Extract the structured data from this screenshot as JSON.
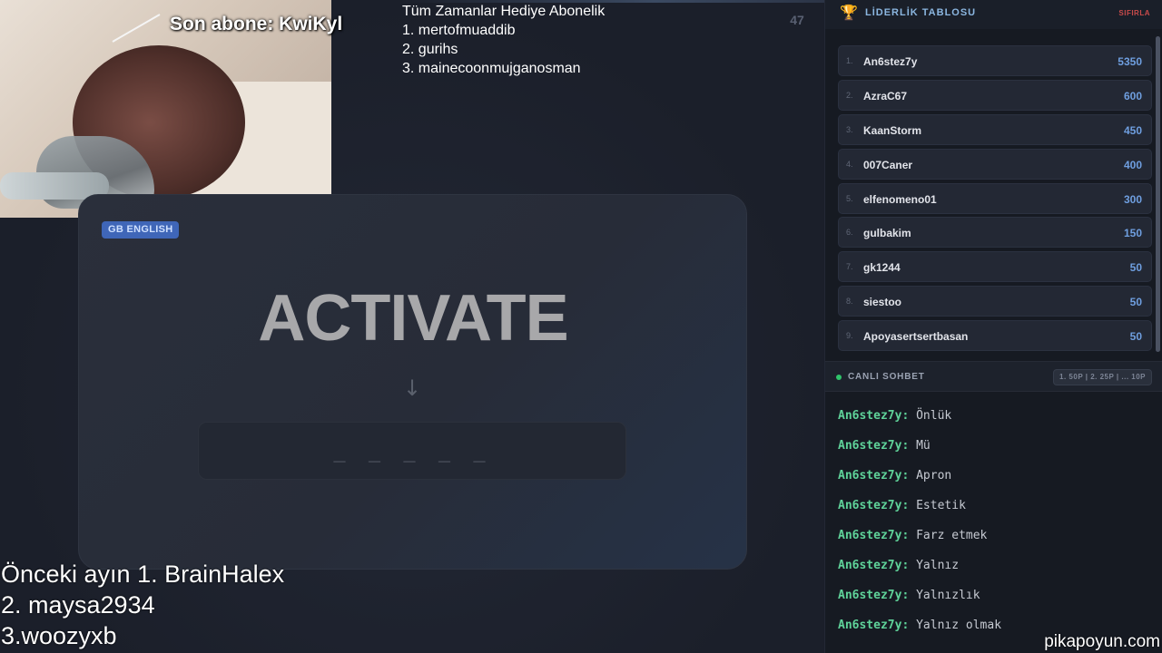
{
  "overlay": {
    "son_abone": "Son abone: KwiKyl",
    "round_counter": "47",
    "gift_list": {
      "title": "Tüm Zamanlar Hediye  Abonelik",
      "items": [
        "1. mertofmuaddib",
        "2. gurihs",
        "3. mainecoonmujganosman"
      ]
    },
    "previous_month": {
      "lines": [
        "Önceki ayın 1. BrainHalex",
        "2. maysa2934",
        "3.woozyxb"
      ]
    },
    "watermark": "pikapoyun.com"
  },
  "game": {
    "language_badge": "GB ENGLISH",
    "word": "ACTIVATE",
    "arrow": "↓",
    "input_placeholder": "_ _ _ _ _"
  },
  "leaderboard": {
    "icon": "trophy-icon",
    "title": "LİDERLİK TABLOSU",
    "reset_label": "SIFIRLA",
    "entries": [
      {
        "rank": "1.",
        "name": "An6stez7y",
        "score": "5350"
      },
      {
        "rank": "2.",
        "name": "AzraC67",
        "score": "600"
      },
      {
        "rank": "3.",
        "name": "KaanStorm",
        "score": "450"
      },
      {
        "rank": "4.",
        "name": "007Caner",
        "score": "400"
      },
      {
        "rank": "5.",
        "name": "elfenomeno01",
        "score": "300"
      },
      {
        "rank": "6.",
        "name": "gulbakim",
        "score": "150"
      },
      {
        "rank": "7.",
        "name": "gk1244",
        "score": "50"
      },
      {
        "rank": "8.",
        "name": "siestoo",
        "score": "50"
      },
      {
        "rank": "9.",
        "name": "Apoyasertsertbasan",
        "score": "50"
      }
    ]
  },
  "chat": {
    "title": "CANLI SOHBET",
    "points_info": "1. 50P | 2. 25P | ... 10P",
    "messages": [
      {
        "user": "An6stez7y:",
        "text": "Önlük"
      },
      {
        "user": "An6stez7y:",
        "text": "Mü"
      },
      {
        "user": "An6stez7y:",
        "text": "Apron"
      },
      {
        "user": "An6stez7y:",
        "text": "Estetik"
      },
      {
        "user": "An6stez7y:",
        "text": "Farz etmek"
      },
      {
        "user": "An6stez7y:",
        "text": "Yalnız"
      },
      {
        "user": "An6stez7y:",
        "text": "Yalnızlık"
      },
      {
        "user": "An6stez7y:",
        "text": "Yalnız olmak"
      }
    ]
  },
  "colors": {
    "accent_blue": "#6f9fe0",
    "chat_user_green": "#5fd39a",
    "live_green": "#2fc46a",
    "reset_red": "#c94b4b",
    "trophy_gold": "#e3b341"
  }
}
